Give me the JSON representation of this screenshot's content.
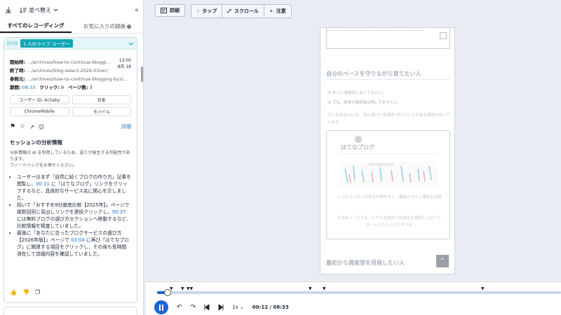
{
  "sidebar": {
    "sort_label": "並べ替え",
    "tabs": [
      "すべてのレコーディング",
      "お気に入りの録画"
    ],
    "live_badge": "1 人のライブ ユーザー",
    "session": {
      "start_label": "開始時:",
      "start_url": "…/archives/how-to-continue-bloggi…",
      "time": "13:00",
      "date": "8月 18",
      "end_label": "終了時:",
      "end_url": "…/archives/blog-select-2026-03ver/",
      "ref_label": "参照元:",
      "ref_url": "…/archives/how-to-continue-blogging-byzi…",
      "duration_label": "期間:",
      "duration": "08:33",
      "clicks_label": "クリック:",
      "clicks": "9",
      "pages_label": "ページ数:",
      "pages": "3"
    },
    "tags": [
      "ユーザー ID: 6c5eby",
      "日本",
      "ChromeMobile",
      "モバイル"
    ],
    "details_link": "詳細",
    "analysis_title": "セッションの分析情報",
    "analysis_note": "分析情報は AI を利用しているため、誤りが発生する可能性があります。",
    "feedback_link": "フィードバックをお寄せください。",
    "summary": [
      {
        "a": "ユーザーはまず「自然に続くブログの作り方」記事を閲覧し、",
        "t": "00:11",
        "b": " に「はてなブログ」リンクをクリックするなど、具体的なサービス名に関心を示しました。"
      },
      {
        "a": "続いて「おすすめ9社徹底比較【2025年】」ページで複数回同じ見出しリンクを連続クリックし、",
        "t": "00:37",
        "b": " には無料ブログの選び方セクションへ移動するなど、比較情報を精査していました。"
      },
      {
        "a": "最後に「あなたに合ったブログサービスの選び方【2026年版】」ページで ",
        "t": "03:04",
        "b": " に再び「はてなブログ」に関連する項目をクリックし、その後も長時間滞在して詳細内容を確認していました。"
      }
    ]
  },
  "toolbar": {
    "details": "詳細",
    "tap": "タップ",
    "scroll": "スクロール",
    "attention": "注意"
  },
  "page": {
    "heading1": "自分のペースを守りながら育てたい人",
    "check1": "すぐに収益化しなくてもいい。",
    "check2": "でも、将来の選択肢は残しておきたい。",
    "para": "そんなあなたには、\"安心感\"と\"拡張性\"のバランスがある環境が向いています。",
    "card_title": "はてなブログ",
    "card_text1": "→ コミュニティの反応が得やすく、独自ドメイン運用も可能",
    "card_text2": "今はゆっくりでも、いずれ本格的に収益化も視野に入れてスタートしたい人におすすめ",
    "heading2": "最初から資産型を目指したい人"
  },
  "player": {
    "speed": "1x",
    "time": "00:12 / 08:33",
    "progress": 0.024
  }
}
